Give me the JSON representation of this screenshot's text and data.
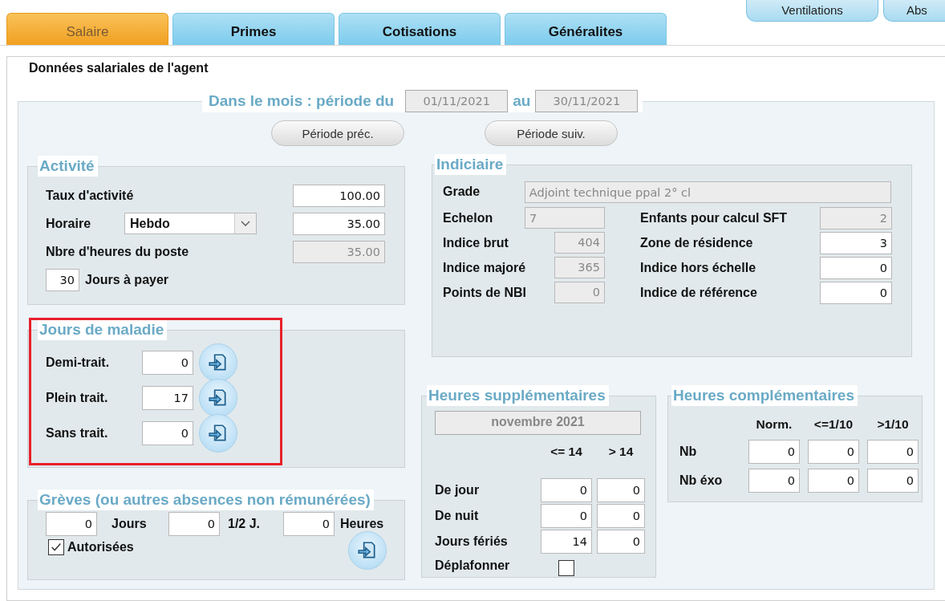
{
  "tabs": [
    {
      "label": "Salaire",
      "selected": true
    },
    {
      "label": "Primes",
      "selected": false
    },
    {
      "label": "Cotisations",
      "selected": false
    },
    {
      "label": "Généralites",
      "selected": false
    }
  ],
  "top_buttons": [
    "Ventilations",
    "Abs"
  ],
  "panel_title": "Données salariales de l'agent",
  "period": {
    "label": "Dans le mois : période du",
    "start": "01/11/2021",
    "connector": "au",
    "end": "30/11/2021",
    "buttons": [
      "Période préc.",
      "Période suiv."
    ]
  },
  "activite": {
    "title": "Activité",
    "taux": {
      "label": "Taux d'activité",
      "value": "100.00"
    },
    "horaire": {
      "label": "Horaire",
      "choice": "Hebdo",
      "value": "35.00"
    },
    "heures_poste": {
      "label": "Nbre d'heures du poste",
      "value": "35.00",
      "disabled": true
    },
    "jours_a_payer": {
      "value": "30",
      "label": "Jours à payer"
    }
  },
  "indiciaire": {
    "title": "Indiciaire",
    "grade": {
      "label": "Grade",
      "value": "Adjoint technique ppal 2° cl",
      "disabled": true
    },
    "left": [
      {
        "label": "Echelon",
        "value": "7",
        "disabled": true,
        "kind": "wide"
      },
      {
        "label": "Indice brut",
        "value": "404",
        "disabled": true,
        "kind": "narrow"
      },
      {
        "label": "Indice majoré",
        "value": "365",
        "disabled": true,
        "kind": "narrow"
      },
      {
        "label": "Points de NBI",
        "value": "0",
        "disabled": true,
        "kind": "narrow"
      }
    ],
    "right": [
      {
        "label": "Enfants pour calcul SFT",
        "value": "2",
        "disabled": true
      },
      {
        "label": "Zone de résidence",
        "value": "3",
        "disabled": false
      },
      {
        "label": "Indice hors échelle",
        "value": "0",
        "disabled": false
      },
      {
        "label": "Indice de référence",
        "value": "0",
        "disabled": false
      }
    ]
  },
  "maladie": {
    "title": "Jours de maladie",
    "highlighted": true,
    "rows": [
      {
        "label": "Demi-trait.",
        "value": "0"
      },
      {
        "label": "Plein trait.",
        "value": "17"
      },
      {
        "label": "Sans trait.",
        "value": "0"
      }
    ]
  },
  "greves": {
    "title": "Grèves (ou autres absences non rémunérées)",
    "fields": [
      {
        "value": "0",
        "label": "Jours"
      },
      {
        "value": "0",
        "label": "1/2 J."
      },
      {
        "value": "0",
        "label": "Heures"
      }
    ],
    "autorisees": {
      "label": "Autorisées",
      "checked": true
    }
  },
  "heures_supp": {
    "title": "Heures supplémentaires",
    "month": "novembre 2021",
    "columns": [
      "<= 14",
      "> 14"
    ],
    "rows": [
      {
        "label": "De jour",
        "values": [
          "0",
          "0"
        ]
      },
      {
        "label": "De nuit",
        "values": [
          "0",
          "0"
        ]
      },
      {
        "label": "Jours fériés",
        "values": [
          "14",
          "0"
        ]
      }
    ],
    "deplafonner": {
      "label": "Déplafonner",
      "checked": false
    }
  },
  "heures_compl": {
    "title": "Heures complémentaires",
    "columns": [
      "Norm.",
      "<=1/10",
      ">1/10"
    ],
    "rows": [
      {
        "label": "Nb",
        "values": [
          "0",
          "0",
          "0"
        ]
      },
      {
        "label": "Nb éxo",
        "values": [
          "0",
          "0",
          "0"
        ]
      }
    ]
  }
}
